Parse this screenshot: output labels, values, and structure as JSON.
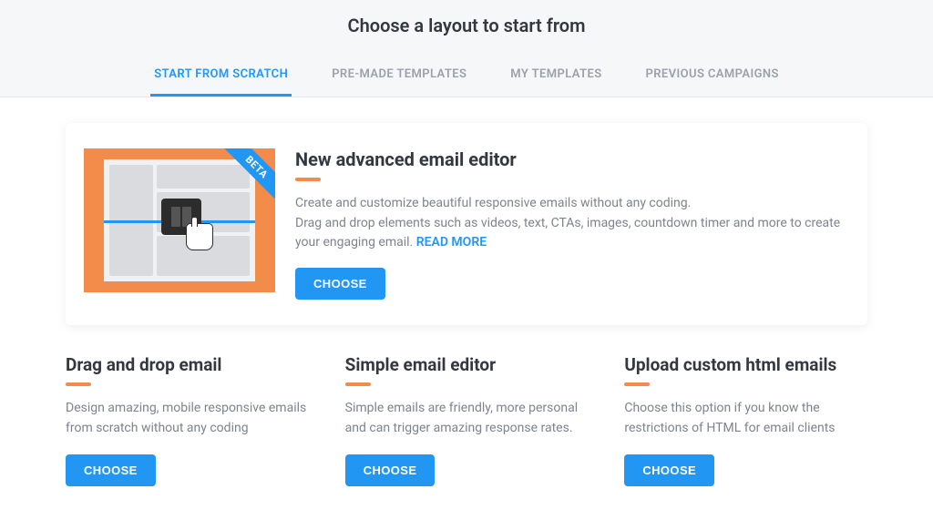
{
  "header": {
    "title": "Choose a layout to start from"
  },
  "tabs": {
    "scratch": "START FROM SCRATCH",
    "premade": "PRE-MADE TEMPLATES",
    "mytemplates": "MY TEMPLATES",
    "previous": "PREVIOUS CAMPAIGNS"
  },
  "featured": {
    "badge": "BETA",
    "title": "New advanced email editor",
    "desc_line1": "Create and customize beautiful responsive emails without any coding.",
    "desc_line2": "Drag and drop elements such as videos, text, CTAs, images, countdown timer and more to create your engaging email. ",
    "read_more": "READ MORE",
    "choose": "CHOOSE"
  },
  "options": {
    "dragdrop": {
      "title": "Drag and drop email",
      "desc": "Design amazing, mobile responsive emails from scratch without any coding",
      "choose": "CHOOSE"
    },
    "simple": {
      "title": "Simple email editor",
      "desc": "Simple emails are friendly, more personal and can trigger amazing response rates.",
      "choose": "CHOOSE"
    },
    "upload": {
      "title": "Upload custom html emails",
      "desc": "Choose this option if you know the restrictions of HTML for email clients",
      "choose": "CHOOSE"
    }
  }
}
